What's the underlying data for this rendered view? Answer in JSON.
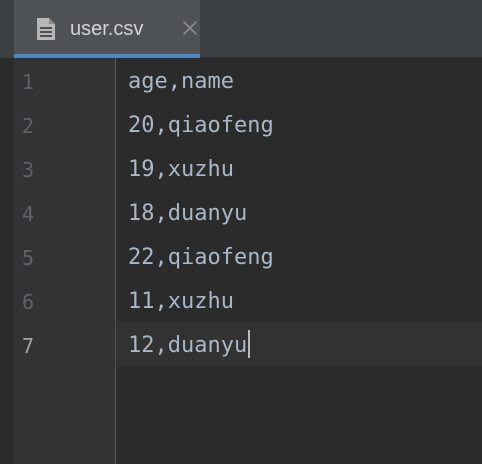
{
  "tab": {
    "label": "user.csv",
    "icon": "csv-file-icon",
    "close": "close-icon"
  },
  "gutter": {
    "line_numbers": [
      "1",
      "2",
      "3",
      "4",
      "5",
      "6",
      "7"
    ]
  },
  "editor": {
    "lines": [
      "age,name",
      "20,qiaofeng",
      "19,xuzhu",
      "18,duanyu",
      "22,qiaofeng",
      "11,xuzhu",
      "12,duanyu"
    ],
    "current_line": "7"
  },
  "colors": {
    "accent": "#4a88c7",
    "background": "#2b2b2b",
    "text": "#a9b7c6"
  }
}
